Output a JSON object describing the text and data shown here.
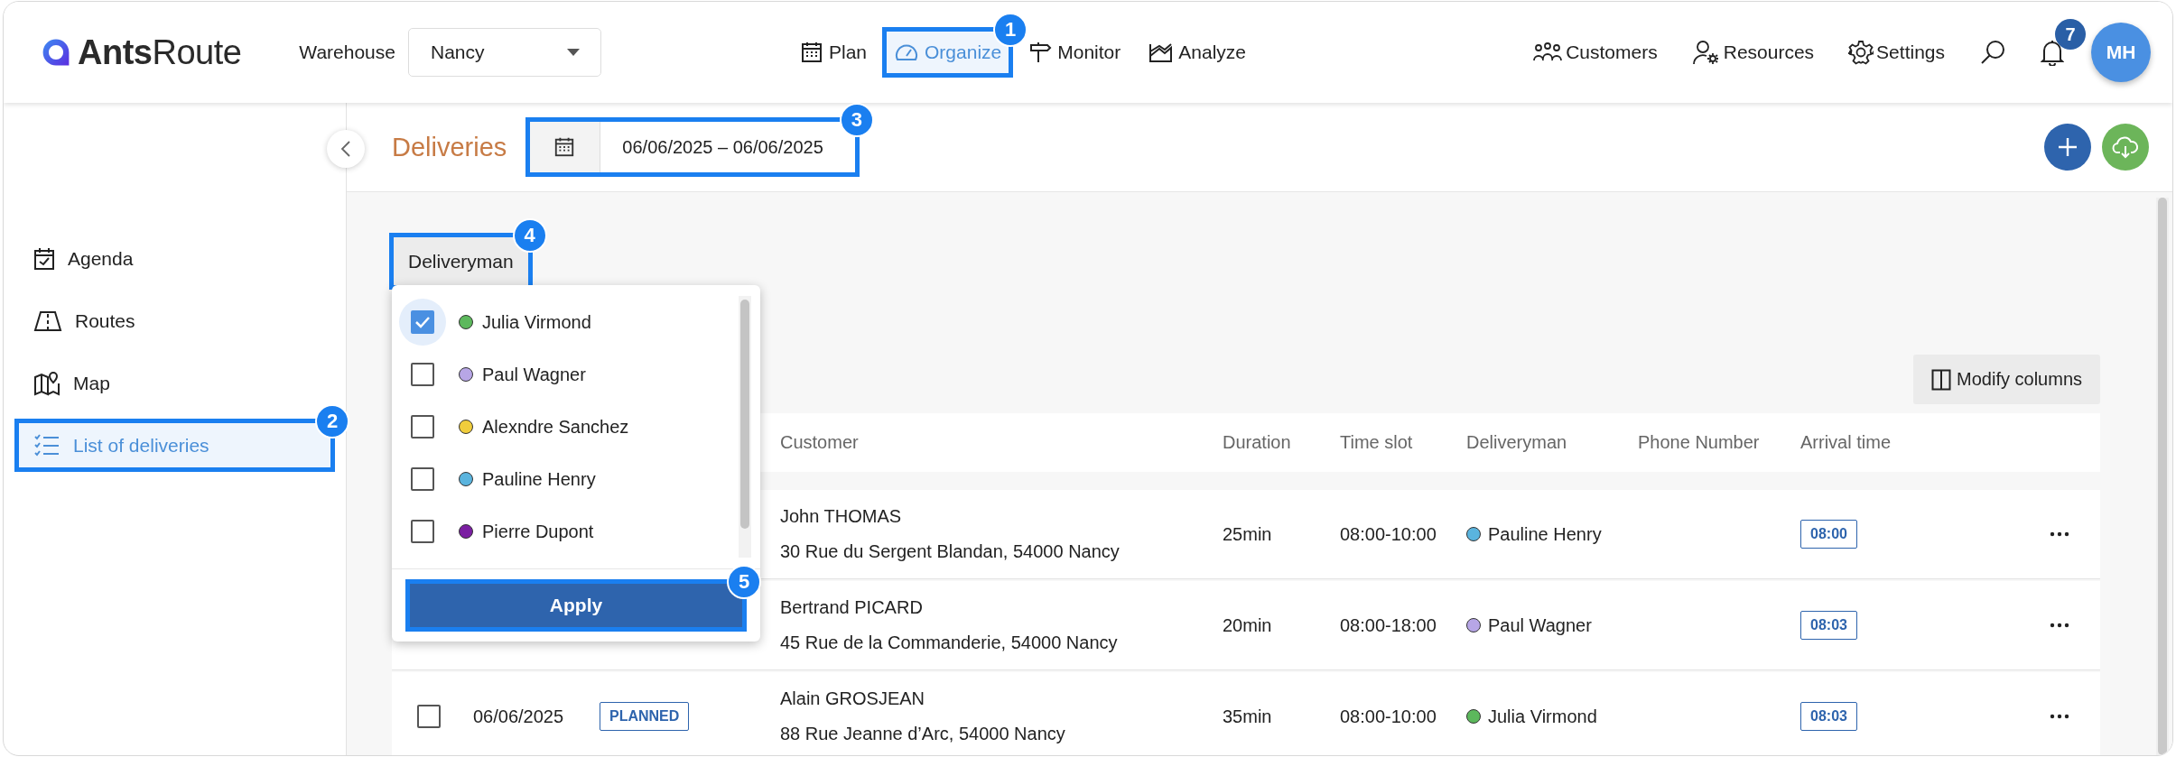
{
  "brand": {
    "name": "**Ants**Route"
  },
  "warehouse": {
    "label": "Warehouse",
    "value": "Nancy"
  },
  "nav": [
    {
      "label": "Plan",
      "selected": false
    },
    {
      "label": "Organize",
      "selected": true,
      "callout": "1"
    },
    {
      "label": "Monitor",
      "selected": false
    },
    {
      "label": "Analyze",
      "selected": false
    }
  ],
  "tools": [
    {
      "label": "Customers"
    },
    {
      "label": "Resources"
    },
    {
      "label": "Settings"
    }
  ],
  "notifications": {
    "count": "7"
  },
  "user": {
    "initials": "MH"
  },
  "sidebar": {
    "items": [
      {
        "label": "Agenda",
        "selected": false
      },
      {
        "label": "Routes",
        "selected": false
      },
      {
        "label": "Map",
        "selected": false
      },
      {
        "label": "List of deliveries",
        "selected": true,
        "callout": "2"
      }
    ]
  },
  "page": {
    "title": "Deliveries",
    "date_range": {
      "value": "06/06/2025 – 06/06/2025",
      "callout": "3"
    }
  },
  "filter": {
    "label": "Deliveryman",
    "callout": "4",
    "expanded": true,
    "options": [
      {
        "name": "Julia Virmond",
        "color": "#5cb85c",
        "checked": true
      },
      {
        "name": "Paul Wagner",
        "color": "#b7a6e6",
        "checked": false
      },
      {
        "name": "Alexndre Sanchez",
        "color": "#f0cd3c",
        "checked": false
      },
      {
        "name": "Pauline Henry",
        "color": "#5ab4de",
        "checked": false
      },
      {
        "name": "Pierre Dupont",
        "color": "#7b1fa2",
        "checked": false
      }
    ],
    "apply": {
      "label": "Apply",
      "callout": "5"
    }
  },
  "modify_columns": {
    "label": "Modify columns"
  },
  "table": {
    "columns": [
      "Customer",
      "Duration",
      "Time slot",
      "Deliveryman",
      "Phone Number",
      "Arrival time"
    ],
    "rows": [
      {
        "customer": "John THOMAS",
        "address": "30 Rue du Sergent Blandan, 54000 Nancy",
        "duration": "25min",
        "time_slot": "08:00-10:00",
        "deliveryman": {
          "name": "Pauline Henry",
          "color": "#5ab4de"
        },
        "arrival": "08:00"
      },
      {
        "customer": "Bertrand PICARD",
        "address": "45 Rue de la Commanderie, 54000 Nancy",
        "duration": "20min",
        "time_slot": "08:00-18:00",
        "deliveryman": {
          "name": "Paul Wagner",
          "color": "#b7a6e6"
        },
        "arrival": "08:03"
      },
      {
        "checked": false,
        "date": "06/06/2025",
        "status": "PLANNED",
        "customer": "Alain GROSJEAN",
        "address": "88 Rue Jeanne d’Arc, 54000 Nancy",
        "duration": "35min",
        "time_slot": "08:00-10:00",
        "deliveryman": {
          "name": "Julia Virmond",
          "color": "#5cb85c"
        },
        "arrival": "08:03"
      }
    ]
  }
}
